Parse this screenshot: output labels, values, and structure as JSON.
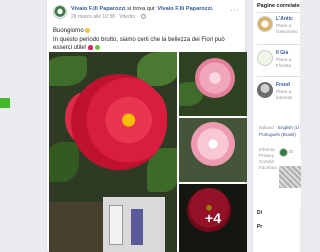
{
  "post": {
    "page_name": "Vivaio F.lli Paparozzi",
    "action_text": "si trova qui:",
    "location": "Vivaio F.lli Paparozzi.",
    "date": "26 marzo alle 10:38",
    "place": "Viterbo",
    "more_label": "···",
    "greeting": "Buongiorno",
    "body": "In questo periodo brutto, siamo certi che la bellezza dei Fiori può esserci utile!",
    "more_photos": "+4"
  },
  "right": {
    "title": "Pagine correlate",
    "items": [
      {
        "name": "L'Antic",
        "sub1": "Piace a",
        "sub2": "Gelsomino"
      },
      {
        "name": "Il Gia",
        "sub1": "Piace a",
        "sub2": "Florista"
      },
      {
        "name": "Freud",
        "sub1": "Piace a",
        "sub2": "Interess"
      }
    ],
    "lang_prefix": "Italiano",
    "lang_1": "English (U",
    "lang_2": "Português (Brasil)",
    "privacy": [
      "Informa",
      "Privacy",
      "Condizi",
      "Faceboo"
    ],
    "mini_prefix": "Di",
    "mini_bottom_1": "Di",
    "mini_bottom_2": "Pr"
  },
  "colors": {
    "link": "#385898",
    "accent_green": "#42b72a",
    "background": "#e9ebee"
  }
}
